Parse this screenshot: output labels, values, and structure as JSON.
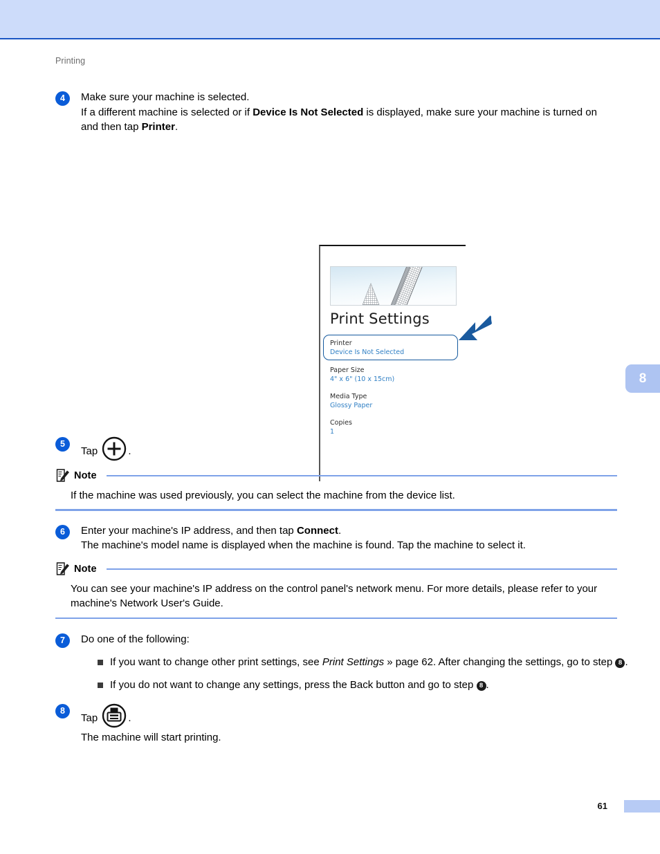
{
  "document": {
    "running_head": "Printing",
    "page_number": "61",
    "chapter_tab": "8"
  },
  "steps": [
    {
      "number": "4",
      "lines": [
        "Make sure your machine is selected.",
        "If a different machine is selected or if Device Is Not Selected is displayed, make sure your machine is turned on and then tap Printer."
      ],
      "line1": "Make sure your machine is selected.",
      "line2_a": "If a different machine is selected or if ",
      "line2_bold1": "Device Is Not Selected",
      "line2_b": " is displayed, make sure your machine is turned on and then tap ",
      "line2_bold2": "Printer",
      "line2_c": "."
    },
    {
      "number": "5",
      "prefix": "Tap ",
      "icon": "plus-circle-icon",
      "suffix": "."
    },
    {
      "number": "6",
      "line1_a": "Enter your machine's IP address, and then tap ",
      "line1_bold": "Connect",
      "line1_b": ".",
      "line2": "The machine's model name is displayed when the machine is found. Tap the machine to select it."
    },
    {
      "number": "7",
      "intro": "Do one of the following:",
      "bullets": [
        {
          "text_a": "If you want to change other print settings, see ",
          "italic": "Print Settings",
          "text_b": " » page 62. After changing the settings, go to step ",
          "ref": "8",
          "text_c": "."
        },
        {
          "text_a": "If you do not want to change any settings, press the Back button and go to step ",
          "ref": "8",
          "text_c": "."
        }
      ]
    },
    {
      "number": "8",
      "prefix": "Tap ",
      "icon": "printer-circle-icon",
      "suffix": ".",
      "line2": "The machine will start printing."
    }
  ],
  "notes": [
    {
      "title": "Note",
      "body": "If the machine was used previously, you can select the machine from the device list."
    },
    {
      "title": "Note",
      "body": "You can see your machine's IP address on the control panel's network menu. For more details, please refer to your machine's Network User's Guide."
    }
  ],
  "figure": {
    "screen_title": "Print Settings",
    "settings": [
      {
        "label": "Printer",
        "value": "Device Is Not Selected",
        "highlighted": true
      },
      {
        "label": "Paper Size",
        "value": "4\" x 6\" (10 x 15cm)",
        "highlighted": false
      },
      {
        "label": "Media Type",
        "value": "Glossy Paper",
        "highlighted": false
      },
      {
        "label": "Copies",
        "value": "1",
        "highlighted": false
      }
    ],
    "annotation_arrow": "arrow-pointing-down-left-icon"
  },
  "colors": {
    "header_band": "#cddcfa",
    "header_rule": "#1a56c4",
    "step_badge": "#0a5cd8",
    "note_rule": "#7ea2e8",
    "chapter_tab": "#aec4f2",
    "setting_value": "#2f7fc4",
    "highlight_border": "#14599e",
    "arrow": "#1a5a9e"
  }
}
